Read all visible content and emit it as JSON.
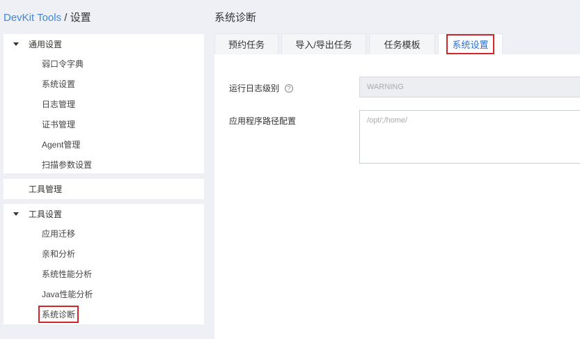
{
  "breadcrumb": {
    "brand": "DevKit Tools",
    "separator": " / ",
    "current": "设置"
  },
  "page_title": "系统诊断",
  "sidebar": {
    "general": {
      "title": "通用设置",
      "items": [
        "弱口令字典",
        "系统设置",
        "日志管理",
        "证书管理",
        "Agent管理",
        "扫描参数设置"
      ]
    },
    "tool_management": {
      "title": "工具管理"
    },
    "tool_settings": {
      "title": "工具设置",
      "items": [
        "应用迁移",
        "亲和分析",
        "系统性能分析",
        "Java性能分析",
        "系统诊断"
      ],
      "selected": "系统诊断"
    }
  },
  "tabs": [
    "预约任务",
    "导入/导出任务",
    "任务模板",
    "系统设置"
  ],
  "active_tab": "系统设置",
  "form": {
    "log_level_label": "运行日志级别",
    "log_level_value": "WARNING",
    "app_path_label": "应用程序路径配置",
    "app_path_value": "/opt/;/home/"
  },
  "icons": {
    "help": "question-circle-icon",
    "expand": "caret-down-icon"
  },
  "colors": {
    "brand": "#3f87d8",
    "highlight": "#d0262b",
    "active_tab_text": "#2e6fcf",
    "background": "#eef0f5"
  }
}
